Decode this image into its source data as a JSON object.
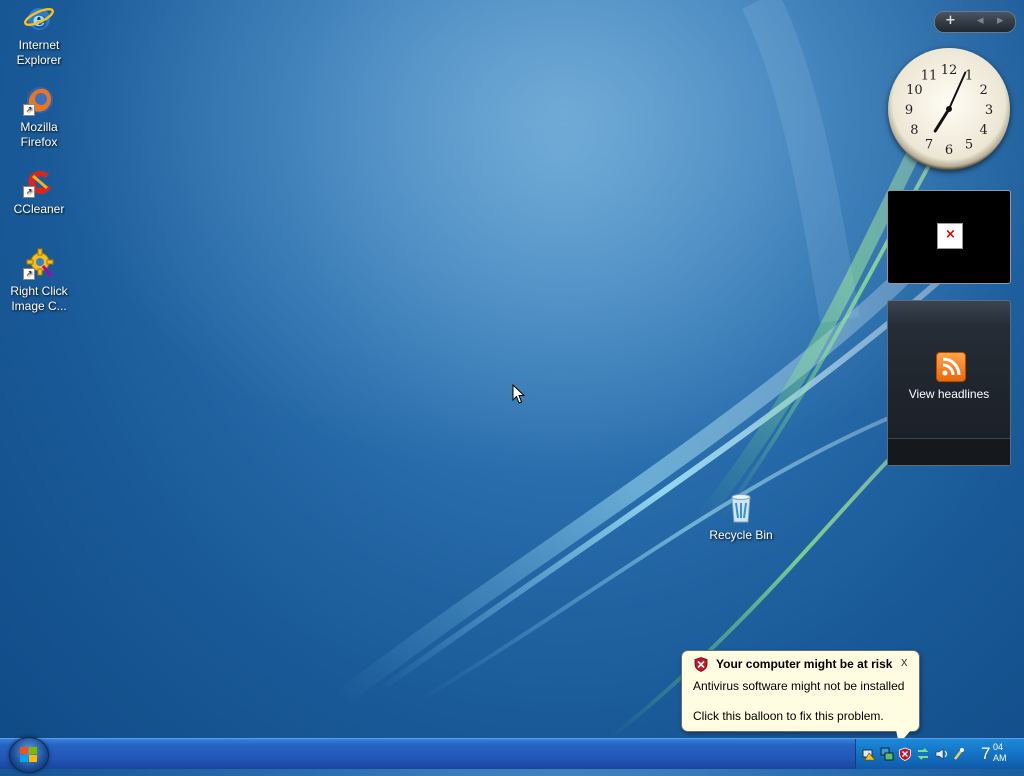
{
  "desktop": {
    "icons": [
      {
        "label_line1": "Internet",
        "label_line2": "Explorer",
        "icon": "internet-explorer-icon"
      },
      {
        "label_line1": "Mozilla",
        "label_line2": "Firefox",
        "icon": "firefox-icon"
      },
      {
        "label_line1": "CCleaner",
        "label_line2": "",
        "icon": "ccleaner-icon"
      },
      {
        "label_line1": "Right Click",
        "label_line2": "Image C...",
        "icon": "gear-icon"
      }
    ],
    "recycle_bin": {
      "label": "Recycle Bin",
      "icon": "recycle-bin-icon"
    }
  },
  "sidebar": {
    "controls": {
      "add": "+",
      "prev": "◂",
      "next": "▸"
    },
    "clock": {
      "numbers": [
        "12",
        "1",
        "2",
        "3",
        "4",
        "5",
        "6",
        "7",
        "8",
        "9",
        "10",
        "11"
      ],
      "hour": 7,
      "minute": 4
    },
    "feed": {
      "label": "View headlines",
      "icon": "rss-icon"
    },
    "frame": {
      "icon": "broken-image-icon"
    }
  },
  "balloon": {
    "title": "Your computer might be at risk",
    "line1": "Antivirus software might not be installed",
    "line2": "Click this balloon to fix this problem.",
    "close": "x"
  },
  "taskbar": {
    "clock_hour": "7",
    "clock_minute": "04",
    "clock_ampm": "AM"
  },
  "colors": {
    "accent": "#2564c4",
    "balloon_bg": "#fffde1",
    "rss": "#e9680f"
  }
}
